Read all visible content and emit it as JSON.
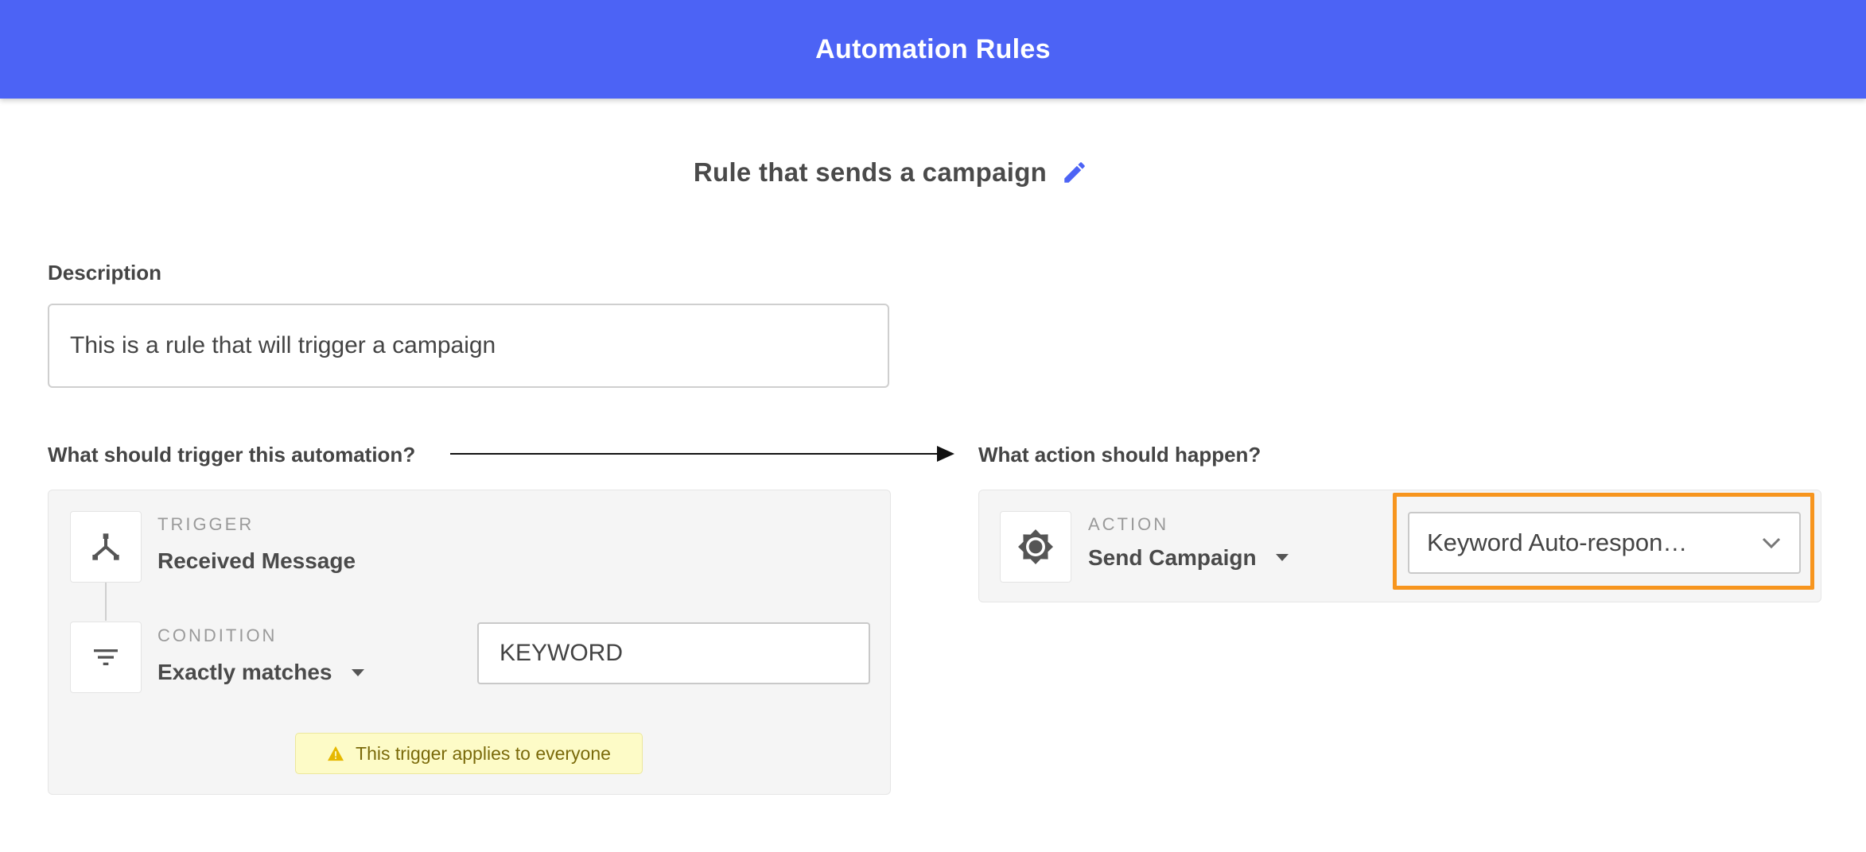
{
  "header": {
    "title": "Automation Rules"
  },
  "rule": {
    "title": "Rule that sends a campaign"
  },
  "description": {
    "label": "Description",
    "value": "This is a rule that will trigger a campaign"
  },
  "trigger_section": {
    "label": "What should trigger this automation?",
    "trigger": {
      "caption": "TRIGGER",
      "value": "Received Message",
      "icon": "fork-icon"
    },
    "condition": {
      "caption": "CONDITION",
      "value": "Exactly matches",
      "icon": "filter-icon",
      "keyword": "KEYWORD"
    },
    "warning": {
      "icon": "warning-icon",
      "text": "This trigger applies to everyone"
    }
  },
  "action_section": {
    "label": "What action should happen?",
    "action": {
      "caption": "ACTION",
      "value": "Send Campaign",
      "icon": "gear-icon"
    },
    "campaign_select": {
      "value": "Keyword Auto-respon…"
    }
  },
  "colors": {
    "header": "#4c63f5",
    "highlight": "#f7951e",
    "warning_bg": "#fdfbc7",
    "pencil": "#4c63f5"
  }
}
